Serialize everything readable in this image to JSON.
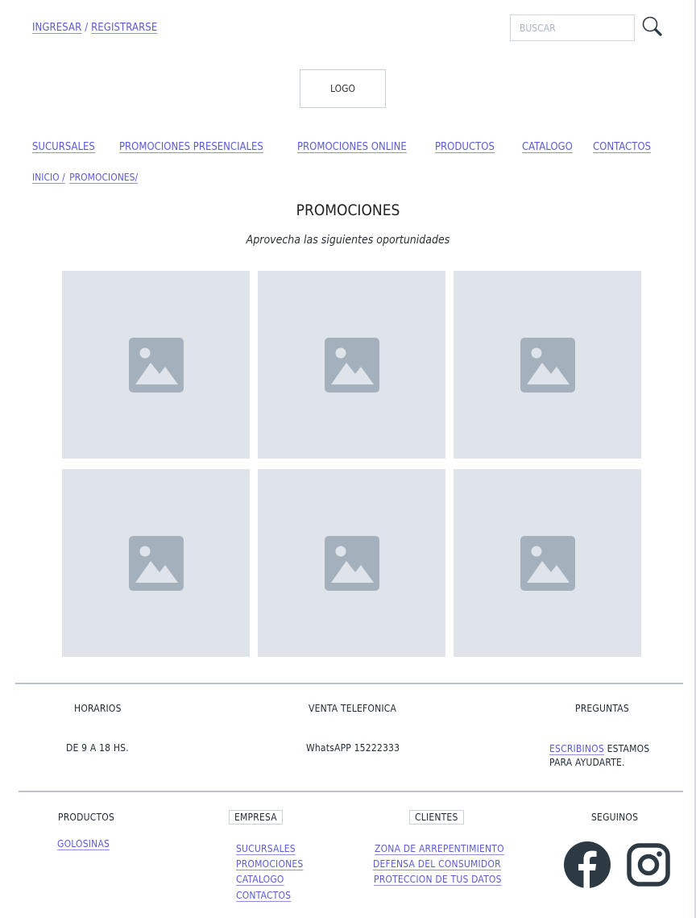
{
  "header": {
    "login_label": "INGRESAR",
    "separator": "/",
    "register_label": "REGISTRARSE",
    "search_placeholder": "BUSCAR",
    "logo_text": "LOGO"
  },
  "nav": {
    "items": [
      "SUCURSALES",
      "PROMOCIONES PRESENCIALES",
      "PROMOCIONES ONLINE",
      "PRODUCTOS",
      "CATALOGO",
      "CONTACTOS"
    ]
  },
  "breadcrumb": {
    "items": [
      "INICIO /",
      "PROMOCIONES/"
    ]
  },
  "main": {
    "title": "PROMOCIONES",
    "subtitle": "Aprovecha las siguientes oportunidades",
    "tile_icon": "image-placeholder-icon"
  },
  "footer_info": {
    "hours_title": "HORARIOS",
    "hours_value": "DE 9 A 18 HS.",
    "phone_title": "VENTA TELEFONICA",
    "phone_value": "WhatsAPP 15222333",
    "faq_title": "PREGUNTAS",
    "faq_link": "ESCRIBINOS",
    "faq_text_1": "ESTAMOS",
    "faq_text_2": "PARA AYUDARTE."
  },
  "footer_links": {
    "products_title": "PRODUCTOS",
    "products_items": [
      "GOLOSINAS"
    ],
    "company_title": "EMPRESA",
    "company_items": [
      "SUCURSALES",
      "PROMOCIONES",
      "CATALOGO",
      "CONTACTOS"
    ],
    "clients_title": "CLIENTES",
    "clients_items": [
      "ZONA DE ARREPENTIMIENTO",
      "DEFENSA DEL CONSUMIDOR",
      "PROTECCION DE TUS DATOS"
    ],
    "social_title": "SEGUINOS",
    "social_icons": [
      "facebook-icon",
      "instagram-icon"
    ]
  },
  "colors": {
    "link": "#5b5bd6",
    "tile_bg": "#dfe4ea",
    "tile_icon": "#a4b0bc",
    "social_icon": "#2d3a44"
  }
}
